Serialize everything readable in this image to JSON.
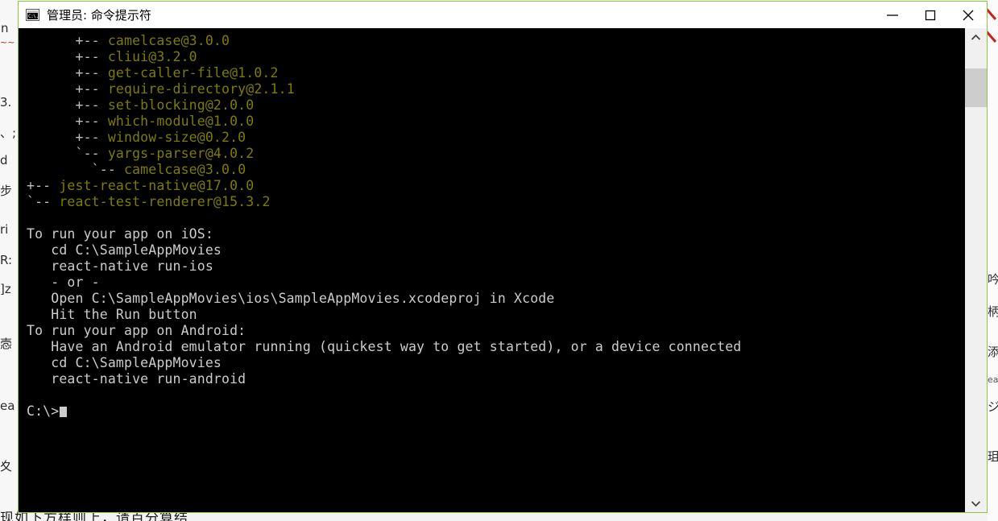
{
  "window": {
    "title": "管理员: 命令提示符",
    "icon": "cmd-console-icon",
    "border_color": "#8cc63e",
    "controls": {
      "minimize_label": "最小化",
      "maximize_label": "最大化",
      "close_label": "关闭"
    }
  },
  "console": {
    "background_color": "#000000",
    "tree_color": "#bfbfbf",
    "package_color": "#7d7d00",
    "text_color": "#cccccc",
    "lines": [
      {
        "type": "tree",
        "text": "      +-- camelcase@3.0.0"
      },
      {
        "type": "tree",
        "text": "      +-- cliui@3.2.0"
      },
      {
        "type": "tree",
        "text": "      +-- get-caller-file@1.0.2"
      },
      {
        "type": "tree",
        "text": "      +-- require-directory@2.1.1"
      },
      {
        "type": "tree",
        "text": "      +-- set-blocking@2.0.0"
      },
      {
        "type": "tree",
        "text": "      +-- which-module@1.0.0"
      },
      {
        "type": "tree",
        "text": "      +-- window-size@0.2.0"
      },
      {
        "type": "tree",
        "text": "      `-- yargs-parser@4.0.2"
      },
      {
        "type": "tree",
        "text": "        `-- camelcase@3.0.0"
      },
      {
        "type": "tree",
        "text": "+-- jest-react-native@17.0.0"
      },
      {
        "type": "tree",
        "text": "`-- react-test-renderer@15.3.2"
      },
      {
        "type": "blank",
        "text": ""
      },
      {
        "type": "text",
        "text": "To run your app on iOS:"
      },
      {
        "type": "text",
        "text": "   cd C:\\SampleAppMovies"
      },
      {
        "type": "text",
        "text": "   react-native run-ios"
      },
      {
        "type": "text",
        "text": "   - or -"
      },
      {
        "type": "text",
        "text": "   Open C:\\SampleAppMovies\\ios\\SampleAppMovies.xcodeproj in Xcode"
      },
      {
        "type": "text",
        "text": "   Hit the Run button"
      },
      {
        "type": "text",
        "text": "To run your app on Android:"
      },
      {
        "type": "text",
        "text": "   Have an Android emulator running (quickest way to get started), or a device connected"
      },
      {
        "type": "text",
        "text": "   cd C:\\SampleAppMovies"
      },
      {
        "type": "text",
        "text": "   react-native run-android"
      },
      {
        "type": "blank",
        "text": ""
      },
      {
        "type": "prompt",
        "text": "C:\\>"
      }
    ]
  },
  "scrollbar": {
    "up_arrow": "chevron-up-icon",
    "down_arrow": "chevron-down-icon",
    "thumb_color": "#cdcdcd",
    "track_color": "#f0f0f0"
  },
  "desktop": {
    "bottom_text": "现如下方样则上，请百分算结",
    "left_glyphs": [
      "n",
      "3.",
      "、;",
      "d",
      "步",
      "ri",
      "R:",
      "]z",
      "悫",
      "ea",
      "夊"
    ],
    "right_glyphs": [
      "吟",
      "柄",
      "添",
      "eac",
      "ジ",
      "珇"
    ]
  }
}
